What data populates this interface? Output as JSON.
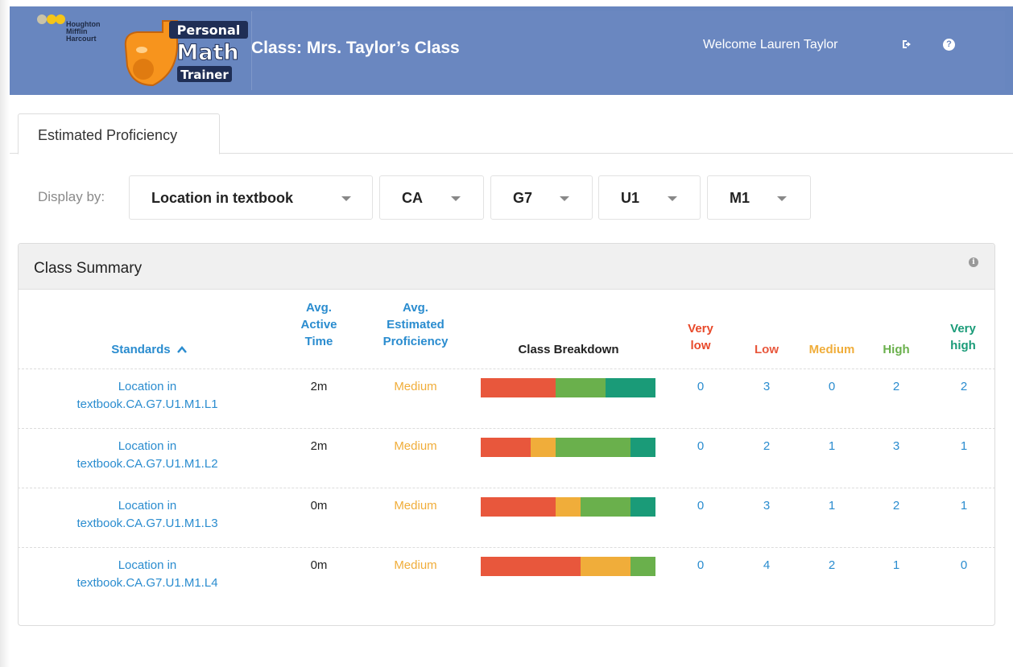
{
  "header": {
    "publisher_lines": [
      "Houghton",
      "Mifflin",
      "Harcourt"
    ],
    "logo_text": [
      "Personal",
      "Math",
      "Trainer"
    ],
    "class_title": "Class: Mrs. Taylor’s Class",
    "welcome": "Welcome Lauren Taylor",
    "icons": [
      "sign-out-icon",
      "help-icon"
    ]
  },
  "tabs": [
    {
      "label": "Estimated Proficiency",
      "active": true
    }
  ],
  "filters": {
    "label": "Display by:",
    "dropdowns": [
      "Location in textbook",
      "CA",
      "G7",
      "U1",
      "M1"
    ]
  },
  "panel": {
    "title": "Class Summary"
  },
  "table": {
    "headers": {
      "standards": "Standards",
      "time": [
        "Avg.",
        "Active",
        "Time"
      ],
      "proficiency": [
        "Avg.",
        "Estimated",
        "Proficiency"
      ],
      "breakdown": "Class Breakdown",
      "very_low": [
        "Very",
        "low"
      ],
      "low": "Low",
      "medium": "Medium",
      "high": "High",
      "very_high": [
        "Very",
        "high"
      ]
    },
    "colors": {
      "very_low": "#e8492a",
      "low": "#e8573c",
      "medium": "#f0ad3a",
      "high": "#6ab04c",
      "very_high": "#1a9b78"
    },
    "rows": [
      {
        "standard": [
          "Location in",
          "textbook.CA.G7.U1.M1.L1"
        ],
        "time": "2m",
        "proficiency": "Medium",
        "counts": [
          "0",
          "3",
          "0",
          "2",
          "2"
        ]
      },
      {
        "standard": [
          "Location in",
          "textbook.CA.G7.U1.M1.L2"
        ],
        "time": "2m",
        "proficiency": "Medium",
        "counts": [
          "0",
          "2",
          "1",
          "3",
          "1"
        ]
      },
      {
        "standard": [
          "Location in",
          "textbook.CA.G7.U1.M1.L3"
        ],
        "time": "0m",
        "proficiency": "Medium",
        "counts": [
          "0",
          "3",
          "1",
          "2",
          "1"
        ]
      },
      {
        "standard": [
          "Location in",
          "textbook.CA.G7.U1.M1.L4"
        ],
        "time": "0m",
        "proficiency": "Medium",
        "counts": [
          "0",
          "4",
          "2",
          "1",
          "0"
        ]
      }
    ]
  }
}
